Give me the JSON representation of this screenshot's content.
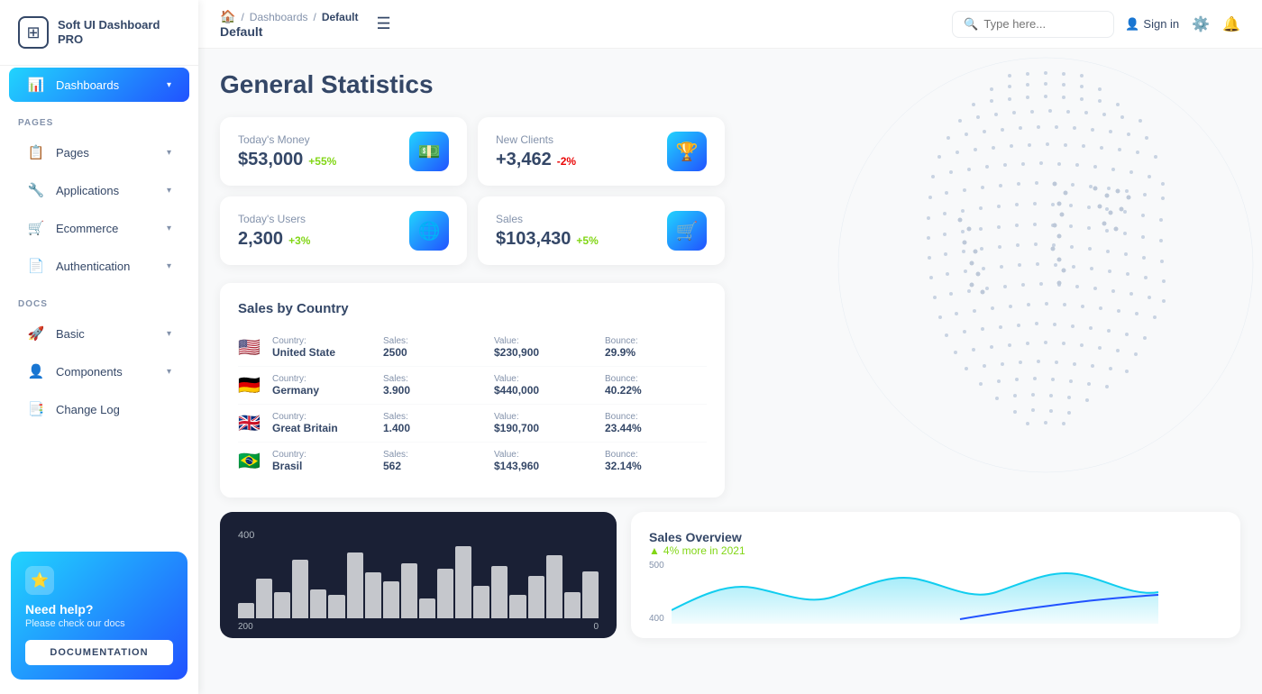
{
  "app": {
    "name": "Soft UI Dashboard PRO"
  },
  "sidebar": {
    "pages_label": "PAGES",
    "docs_label": "DOCS",
    "items": [
      {
        "id": "dashboards",
        "label": "Dashboards",
        "icon": "📊",
        "active": true,
        "hasChevron": true
      },
      {
        "id": "pages",
        "label": "Pages",
        "icon": "📋",
        "active": false,
        "hasChevron": true
      },
      {
        "id": "applications",
        "label": "Applications",
        "icon": "🔧",
        "active": false,
        "hasChevron": true
      },
      {
        "id": "ecommerce",
        "label": "Ecommerce",
        "icon": "🛒",
        "active": false,
        "hasChevron": true
      },
      {
        "id": "authentication",
        "label": "Authentication",
        "icon": "📄",
        "active": false,
        "hasChevron": true
      }
    ],
    "docs_items": [
      {
        "id": "basic",
        "label": "Basic",
        "icon": "🚀",
        "hasChevron": true
      },
      {
        "id": "components",
        "label": "Components",
        "icon": "👤",
        "hasChevron": true
      },
      {
        "id": "changelog",
        "label": "Change Log",
        "icon": "📑",
        "hasChevron": false
      }
    ],
    "help": {
      "title": "Need help?",
      "subtitle": "Please check our docs",
      "button_label": "DOCUMENTATION"
    }
  },
  "navbar": {
    "breadcrumb": {
      "home": "🏠",
      "sep1": "/",
      "link": "Dashboards",
      "sep2": "/",
      "current": "Default"
    },
    "title": "Default",
    "search_placeholder": "Type here...",
    "signin_label": "Sign in",
    "menu_icon": "☰"
  },
  "page": {
    "title": "General Statistics"
  },
  "stats": [
    {
      "label": "Today's Money",
      "value": "$53,000",
      "change": "+55%",
      "change_type": "positive",
      "icon": "💵"
    },
    {
      "label": "New Clients",
      "value": "+3,462",
      "change": "-2%",
      "change_type": "negative",
      "icon": "🏆"
    },
    {
      "label": "Today's Users",
      "value": "2,300",
      "change": "+3%",
      "change_type": "positive",
      "icon": "🌐"
    },
    {
      "label": "Sales",
      "value": "$103,430",
      "change": "+5%",
      "change_type": "positive",
      "icon": "🛒"
    }
  ],
  "sales_by_country": {
    "title": "Sales by Country",
    "columns": [
      "Country:",
      "Sales:",
      "Value:",
      "Bounce:"
    ],
    "rows": [
      {
        "flag": "🇺🇸",
        "country": "United State",
        "sales": "2500",
        "value": "$230,900",
        "bounce": "29.9%"
      },
      {
        "flag": "🇩🇪",
        "country": "Germany",
        "sales": "3.900",
        "value": "$440,000",
        "bounce": "40.22%"
      },
      {
        "flag": "🇬🇧",
        "country": "Great Britain",
        "sales": "1.400",
        "value": "$190,700",
        "bounce": "23.44%"
      },
      {
        "flag": "🇧🇷",
        "country": "Brasil",
        "sales": "562",
        "value": "$143,960",
        "bounce": "32.14%"
      }
    ]
  },
  "bar_chart": {
    "title": "",
    "y_labels": [
      "400",
      "200",
      "0"
    ],
    "bars": [
      12,
      30,
      20,
      45,
      22,
      18,
      50,
      35,
      28,
      42,
      15,
      38,
      55,
      25,
      40,
      18,
      32,
      48,
      20,
      36
    ]
  },
  "sales_overview": {
    "title": "Sales Overview",
    "subtitle": "4% more in 2021",
    "y_labels": [
      "500",
      "400"
    ]
  }
}
